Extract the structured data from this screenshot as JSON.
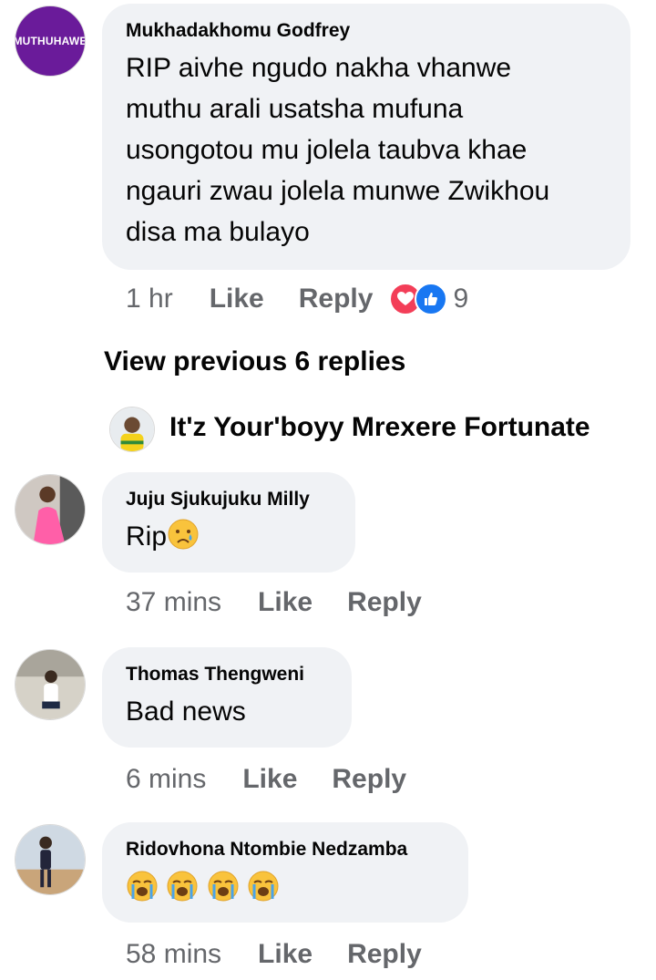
{
  "comments": [
    {
      "avatar_text": "MUTHUHAWE",
      "author": "Mukhadakhomu Godfrey",
      "lines": [
        "RIP aivhe ngudo nakha vhanwe",
        "muthu arali usatsha mufuna",
        "usongotou mu jolela taubva khae",
        "ngauri zwau jolela munwe Zwikhou",
        "disa ma bulayo"
      ],
      "time": "1 hr",
      "like_label": "Like",
      "reply_label": "Reply",
      "reaction_count": "9"
    }
  ],
  "view_previous": "View previous 6 replies",
  "reply_preview_user": "It'z Your'boyy Mrexere Fortunate",
  "replies": [
    {
      "author": "Juju Sjukujuku Milly",
      "text": "Rip",
      "emoji": "crying-face",
      "time": "37 mins",
      "like_label": "Like",
      "reply_label": "Reply"
    },
    {
      "author": "Thomas Thengweni",
      "text": "Bad news",
      "time": "6 mins",
      "like_label": "Like",
      "reply_label": "Reply"
    },
    {
      "author": "Ridovhona Ntombie Nedzamba",
      "text": "",
      "emoji": "loudly-crying-face x4",
      "time": "58 mins",
      "like_label": "Like",
      "reply_label": "Reply"
    }
  ],
  "colors": {
    "bubble": "#f0f2f5",
    "meta": "#65676b",
    "like_blue": "#1877f2",
    "heart_red": "#f33e58"
  }
}
